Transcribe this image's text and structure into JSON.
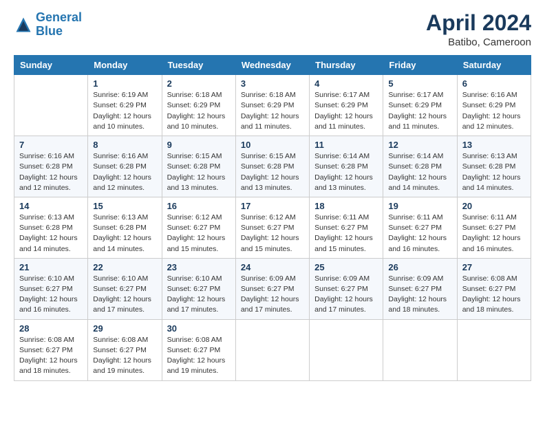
{
  "logo": {
    "line1": "General",
    "line2": "Blue"
  },
  "title": "April 2024",
  "subtitle": "Batibo, Cameroon",
  "weekdays": [
    "Sunday",
    "Monday",
    "Tuesday",
    "Wednesday",
    "Thursday",
    "Friday",
    "Saturday"
  ],
  "weeks": [
    [
      {
        "num": "",
        "info": ""
      },
      {
        "num": "1",
        "info": "Sunrise: 6:19 AM\nSunset: 6:29 PM\nDaylight: 12 hours\nand 10 minutes."
      },
      {
        "num": "2",
        "info": "Sunrise: 6:18 AM\nSunset: 6:29 PM\nDaylight: 12 hours\nand 10 minutes."
      },
      {
        "num": "3",
        "info": "Sunrise: 6:18 AM\nSunset: 6:29 PM\nDaylight: 12 hours\nand 11 minutes."
      },
      {
        "num": "4",
        "info": "Sunrise: 6:17 AM\nSunset: 6:29 PM\nDaylight: 12 hours\nand 11 minutes."
      },
      {
        "num": "5",
        "info": "Sunrise: 6:17 AM\nSunset: 6:29 PM\nDaylight: 12 hours\nand 11 minutes."
      },
      {
        "num": "6",
        "info": "Sunrise: 6:16 AM\nSunset: 6:29 PM\nDaylight: 12 hours\nand 12 minutes."
      }
    ],
    [
      {
        "num": "7",
        "info": "Sunrise: 6:16 AM\nSunset: 6:28 PM\nDaylight: 12 hours\nand 12 minutes."
      },
      {
        "num": "8",
        "info": "Sunrise: 6:16 AM\nSunset: 6:28 PM\nDaylight: 12 hours\nand 12 minutes."
      },
      {
        "num": "9",
        "info": "Sunrise: 6:15 AM\nSunset: 6:28 PM\nDaylight: 12 hours\nand 13 minutes."
      },
      {
        "num": "10",
        "info": "Sunrise: 6:15 AM\nSunset: 6:28 PM\nDaylight: 12 hours\nand 13 minutes."
      },
      {
        "num": "11",
        "info": "Sunrise: 6:14 AM\nSunset: 6:28 PM\nDaylight: 12 hours\nand 13 minutes."
      },
      {
        "num": "12",
        "info": "Sunrise: 6:14 AM\nSunset: 6:28 PM\nDaylight: 12 hours\nand 14 minutes."
      },
      {
        "num": "13",
        "info": "Sunrise: 6:13 AM\nSunset: 6:28 PM\nDaylight: 12 hours\nand 14 minutes."
      }
    ],
    [
      {
        "num": "14",
        "info": "Sunrise: 6:13 AM\nSunset: 6:28 PM\nDaylight: 12 hours\nand 14 minutes."
      },
      {
        "num": "15",
        "info": "Sunrise: 6:13 AM\nSunset: 6:28 PM\nDaylight: 12 hours\nand 14 minutes."
      },
      {
        "num": "16",
        "info": "Sunrise: 6:12 AM\nSunset: 6:27 PM\nDaylight: 12 hours\nand 15 minutes."
      },
      {
        "num": "17",
        "info": "Sunrise: 6:12 AM\nSunset: 6:27 PM\nDaylight: 12 hours\nand 15 minutes."
      },
      {
        "num": "18",
        "info": "Sunrise: 6:11 AM\nSunset: 6:27 PM\nDaylight: 12 hours\nand 15 minutes."
      },
      {
        "num": "19",
        "info": "Sunrise: 6:11 AM\nSunset: 6:27 PM\nDaylight: 12 hours\nand 16 minutes."
      },
      {
        "num": "20",
        "info": "Sunrise: 6:11 AM\nSunset: 6:27 PM\nDaylight: 12 hours\nand 16 minutes."
      }
    ],
    [
      {
        "num": "21",
        "info": "Sunrise: 6:10 AM\nSunset: 6:27 PM\nDaylight: 12 hours\nand 16 minutes."
      },
      {
        "num": "22",
        "info": "Sunrise: 6:10 AM\nSunset: 6:27 PM\nDaylight: 12 hours\nand 17 minutes."
      },
      {
        "num": "23",
        "info": "Sunrise: 6:10 AM\nSunset: 6:27 PM\nDaylight: 12 hours\nand 17 minutes."
      },
      {
        "num": "24",
        "info": "Sunrise: 6:09 AM\nSunset: 6:27 PM\nDaylight: 12 hours\nand 17 minutes."
      },
      {
        "num": "25",
        "info": "Sunrise: 6:09 AM\nSunset: 6:27 PM\nDaylight: 12 hours\nand 17 minutes."
      },
      {
        "num": "26",
        "info": "Sunrise: 6:09 AM\nSunset: 6:27 PM\nDaylight: 12 hours\nand 18 minutes."
      },
      {
        "num": "27",
        "info": "Sunrise: 6:08 AM\nSunset: 6:27 PM\nDaylight: 12 hours\nand 18 minutes."
      }
    ],
    [
      {
        "num": "28",
        "info": "Sunrise: 6:08 AM\nSunset: 6:27 PM\nDaylight: 12 hours\nand 18 minutes."
      },
      {
        "num": "29",
        "info": "Sunrise: 6:08 AM\nSunset: 6:27 PM\nDaylight: 12 hours\nand 19 minutes."
      },
      {
        "num": "30",
        "info": "Sunrise: 6:08 AM\nSunset: 6:27 PM\nDaylight: 12 hours\nand 19 minutes."
      },
      {
        "num": "",
        "info": ""
      },
      {
        "num": "",
        "info": ""
      },
      {
        "num": "",
        "info": ""
      },
      {
        "num": "",
        "info": ""
      }
    ]
  ]
}
